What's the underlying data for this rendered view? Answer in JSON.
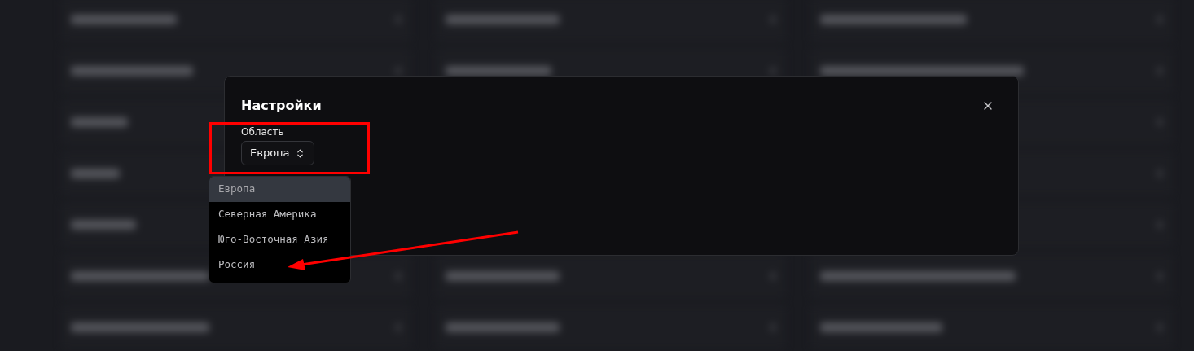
{
  "dialog": {
    "title": "Настройки",
    "field": {
      "label": "Область",
      "value": "Европа"
    }
  },
  "dropdown": {
    "options": [
      {
        "label": "Европа",
        "selected": true
      },
      {
        "label": "Северная Америка",
        "selected": false
      },
      {
        "label": "Юго-Восточная Азия",
        "selected": false
      },
      {
        "label": "Россия",
        "selected": false
      }
    ]
  }
}
